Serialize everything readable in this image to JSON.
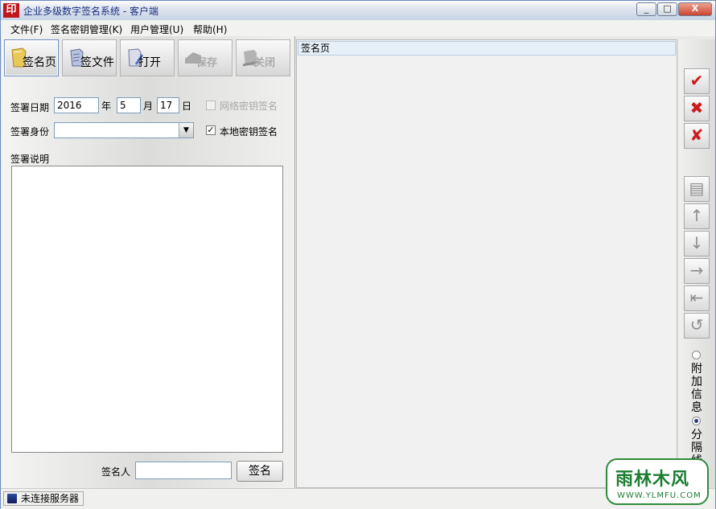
{
  "window": {
    "icon_text": "印",
    "title": "企业多级数字签名系统 - 客户端",
    "minimize": "_",
    "maximize": "□",
    "close": "X"
  },
  "menu": [
    "文件(F)",
    "签名密钥管理(K)",
    "用户管理(U)",
    "帮助(H)"
  ],
  "toolbar": [
    {
      "label": "签名页",
      "icon": "page-icon",
      "enabled": true
    },
    {
      "label": "签文件",
      "icon": "file-icon",
      "enabled": true
    },
    {
      "label": "打开",
      "icon": "open-icon",
      "enabled": true
    },
    {
      "label": "保存",
      "icon": "save-icon",
      "enabled": false
    },
    {
      "label": "关闭",
      "icon": "close-doc-icon",
      "enabled": false
    }
  ],
  "form": {
    "date_label": "签署日期",
    "year": "2016",
    "year_unit": "年",
    "month": "5",
    "month_unit": "月",
    "day": "17",
    "day_unit": "日",
    "network_key_label": "网络密钥签名",
    "network_key_checked": false,
    "identity_label": "签署身份",
    "identity_value": "",
    "local_key_label": "本地密钥签名",
    "local_key_checked": true,
    "check_mark": "✓",
    "description_label": "签署说明",
    "description_value": "",
    "signer_label": "签名人",
    "signer_value": "",
    "sign_button": "签名"
  },
  "document": {
    "tab_label": "签名页"
  },
  "side_tools": [
    {
      "icon": "sign-check-icon",
      "glyph": "✔",
      "enabled": true
    },
    {
      "icon": "delete-sign-icon",
      "glyph": "✖",
      "enabled": true
    },
    {
      "icon": "clear-sign-icon",
      "glyph": "✘",
      "enabled": true
    },
    {
      "icon": "page-doc-icon",
      "glyph": "▤",
      "enabled": false
    },
    {
      "icon": "arrow-up-icon",
      "glyph": "↑",
      "enabled": false
    },
    {
      "icon": "arrow-down-icon",
      "glyph": "↓",
      "enabled": false
    },
    {
      "icon": "arrow-right-icon",
      "glyph": "→",
      "enabled": false
    },
    {
      "icon": "arrow-left-indent-icon",
      "glyph": "⇤",
      "enabled": false
    },
    {
      "icon": "undo-icon",
      "glyph": "↺",
      "enabled": false
    }
  ],
  "side_options": {
    "extra_info_label": "附加信息",
    "extra_info_selected": false,
    "separator_label": "分隔线",
    "separator_selected": true
  },
  "status": {
    "text": "未连接服务器"
  },
  "watermark": {
    "text": "雨林木风",
    "url": "WWW.YLMFU.COM"
  }
}
